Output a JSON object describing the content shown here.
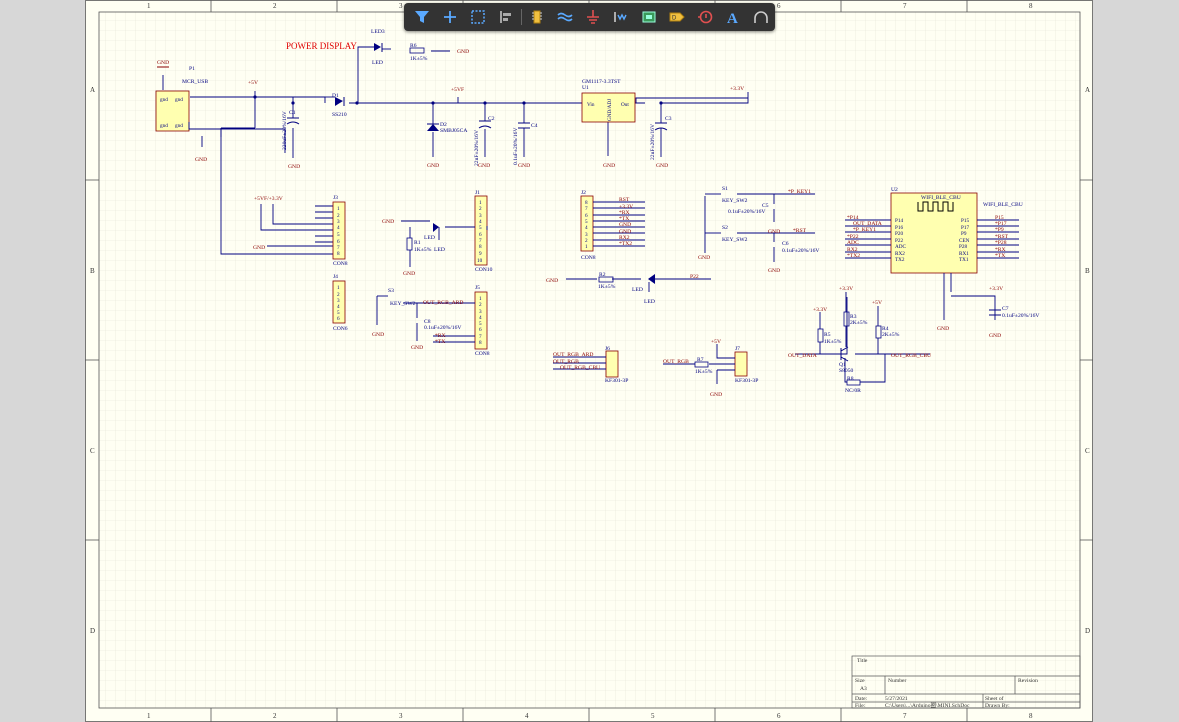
{
  "toolbar": {
    "buttons": [
      {
        "name": "filter-button",
        "icon": "filter-icon"
      },
      {
        "name": "cross-probe-button",
        "icon": "crosshair-icon"
      },
      {
        "name": "select-area-button",
        "icon": "dashed-rect-icon"
      },
      {
        "name": "align-button",
        "icon": "align-icon"
      },
      {
        "name": "place-part-button",
        "icon": "component-icon"
      },
      {
        "name": "place-bus-button",
        "icon": "bus-icon"
      },
      {
        "name": "place-gnd-button",
        "icon": "ground-icon"
      },
      {
        "name": "net-label-button",
        "icon": "net-label-icon"
      },
      {
        "name": "place-sheet-button",
        "icon": "sheet-icon"
      },
      {
        "name": "place-port-button",
        "icon": "port-icon"
      },
      {
        "name": "no-erc-button",
        "icon": "no-erc-icon"
      },
      {
        "name": "place-text-button",
        "icon": "text-icon"
      },
      {
        "name": "place-arc-button",
        "icon": "arc-icon"
      }
    ]
  },
  "zones": {
    "columns": [
      "1",
      "2",
      "3",
      "4",
      "5",
      "6",
      "7",
      "8"
    ],
    "rows": [
      "A",
      "B",
      "C",
      "D"
    ]
  },
  "schematic": {
    "power_display_label": "POWER DISPLAY",
    "usb": {
      "des": "P1",
      "name": "MCR_USB",
      "pins": [
        "gnd",
        "gnd",
        "gnd",
        "gnd"
      ]
    },
    "d1": {
      "des": "D1",
      "val": "SS210"
    },
    "d2": {
      "des": "D2",
      "val": "SMBJ05CA"
    },
    "led3": {
      "des": "LED3",
      "val": "LED"
    },
    "r6": {
      "des": "R6",
      "val": "1K±5%"
    },
    "c1": {
      "val": "220uF±20%/16V"
    },
    "c2": {
      "val": "22uF±20%/16V"
    },
    "c3": {
      "val": "22uF±20%/16V"
    },
    "c4": {
      "val": "0.1uF±20%/16V"
    },
    "u1": {
      "des": "U1",
      "name": "GM1117-3.3TST",
      "vin": "Vin",
      "out": "Out",
      "gnd": "GND/ADJ"
    },
    "j1": {
      "des": "J1",
      "name": "CON10"
    },
    "j2": {
      "des": "J2",
      "name": "CON8"
    },
    "j3": {
      "des": "J3",
      "name": "CON8"
    },
    "j4": {
      "des": "J4",
      "name": "CON6"
    },
    "j5": {
      "des": "J5",
      "name": "CON8"
    },
    "j6": {
      "des": "J6",
      "name": "KF301-3P"
    },
    "j7": {
      "des": "J7",
      "name": "KF301-3P"
    },
    "u2": {
      "des": "U2",
      "name": "WIFI_BLE_CBU",
      "label": "WIFI_BLE_CBU",
      "left_pins": [
        "P14",
        "P16",
        "P20",
        "P22",
        "ADC",
        "RX2",
        "TX2"
      ],
      "right_pins": [
        "P15",
        "P17",
        "P9",
        "CEN",
        "P28",
        "RX1",
        "TX1"
      ]
    },
    "j2_nets": [
      "RST",
      "+3.3V",
      "*RX",
      "*TX",
      "GND",
      "GND",
      "RX2",
      "*TX2"
    ],
    "u2_left_nets": [
      "*P14",
      "OUT_DATA",
      "*P_KEY1",
      "*P22",
      "ADC",
      "RX2",
      "*TX2"
    ],
    "u2_right_nets": [
      "P15",
      "*P17",
      "*P9",
      "*RST",
      "*P28",
      "*RX",
      "*TX"
    ],
    "power": {
      "gnd": "GND",
      "p5v": "+5V",
      "p5vf": "+5VF",
      "p33v": "+3.3V",
      "p5v33": "+5VF/+3.3V"
    },
    "keys": {
      "s1": "S1",
      "s2": "S2",
      "s3": "S3",
      "sw": "KEY_SW2",
      "c5": "C5",
      "c6": "C6",
      "c8": "C8",
      "cval": "0.1uF±20%/16V",
      "net1": "*P_KEY1",
      "net2": "*RST"
    },
    "leds": {
      "r1": "R1",
      "r2": "R2",
      "r7": "R7",
      "rval": "1K±5%",
      "led": "LED",
      "p22": "P22",
      "p20": "OUT_RGB_ARD"
    },
    "rgb": {
      "ard": "OUT_RGB_ARD",
      "cbu": "OUT_RGB_CBU",
      "rgb": "OUT_RGB",
      "rgbnet": "OUT_RGB"
    },
    "q1": {
      "des": "Q1",
      "val": "S8050",
      "r3": "R3",
      "r4": "R4",
      "r5": "R5",
      "r8": "R8",
      "r3val": "2K±5%",
      "r4val": "2K±5%",
      "r5val": "1K±5%",
      "r8val": "NC/0R",
      "data": "OUT_DATA",
      "cbu": "OUT_RGB_CBU"
    },
    "c7": {
      "des": "C7",
      "val": "0.1uF±20%/16V"
    }
  },
  "titleblock": {
    "title": "Title",
    "size": "Size",
    "sizeval": "A3",
    "number": "Number",
    "revision": "Revision",
    "date": "Date:",
    "dateval": "5/27/2021",
    "sheet": "Sheet of",
    "file": "File:",
    "fileval": "C:\\Users\\...\\Arduino圈\\MINI.SchDoc",
    "drawn": "Drawn By:"
  }
}
